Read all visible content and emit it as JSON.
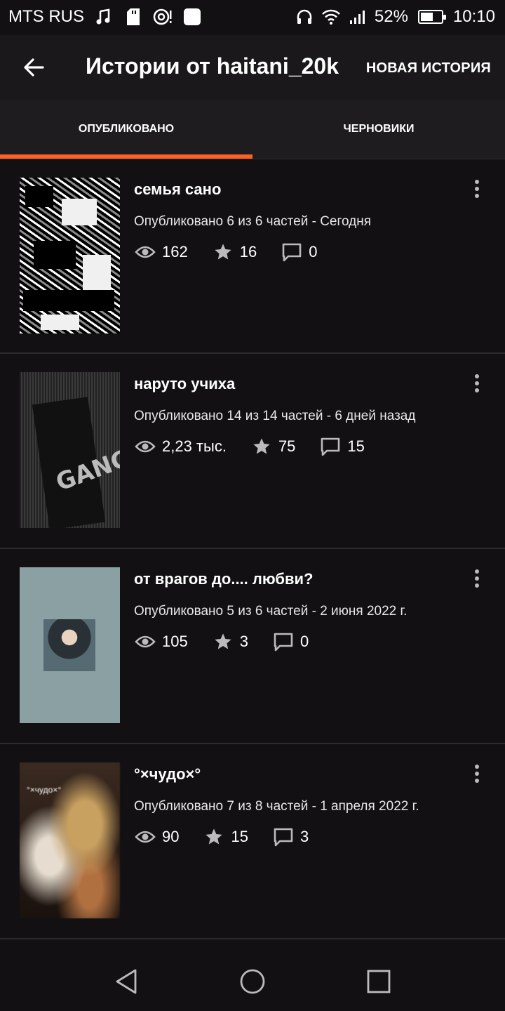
{
  "status_bar": {
    "carrier": "MTS RUS",
    "battery_percent": "52%",
    "battery_level": 0.52,
    "time": "10:10",
    "icons": [
      "music-icon",
      "sd-card-icon",
      "hotspot-icon",
      "app-icon",
      "headphones-icon",
      "wifi-icon",
      "signal-icon",
      "battery-icon"
    ]
  },
  "app_bar": {
    "back_icon": "arrow-left-icon",
    "title": "Истории от haitani_20k",
    "new_story_label": "НОВАЯ ИСТОРИЯ"
  },
  "tabs": {
    "published": "ОПУБЛИКОВАНО",
    "drafts": "ЧЕРНОВИКИ",
    "active": "published",
    "accent_color": "#ff6122"
  },
  "stories": [
    {
      "title": "семья сано",
      "meta": "Опубликовано 6 из 6 частей - Сегодня",
      "views": "162",
      "votes": "16",
      "comments": "0"
    },
    {
      "title": "наруто учиха",
      "meta": "Опубликовано 14 из 14 частей - 6 дней назад",
      "views": "2,23 тыс.",
      "votes": "75",
      "comments": "15",
      "cover_text": "GANG"
    },
    {
      "title": "от врагов до.... любви?",
      "meta": "Опубликовано 5 из 6 частей - 2 июня 2022 г.",
      "views": "105",
      "votes": "3",
      "comments": "0"
    },
    {
      "title": "°×чудо×°",
      "meta": "Опубликовано 7 из 8 частей - 1 апреля 2022 г.",
      "views": "90",
      "votes": "15",
      "comments": "3",
      "cover_text": "°×чудо×°"
    }
  ],
  "nav_bar": {
    "icons": [
      "back-triangle-icon",
      "home-circle-icon",
      "recents-square-icon"
    ]
  }
}
